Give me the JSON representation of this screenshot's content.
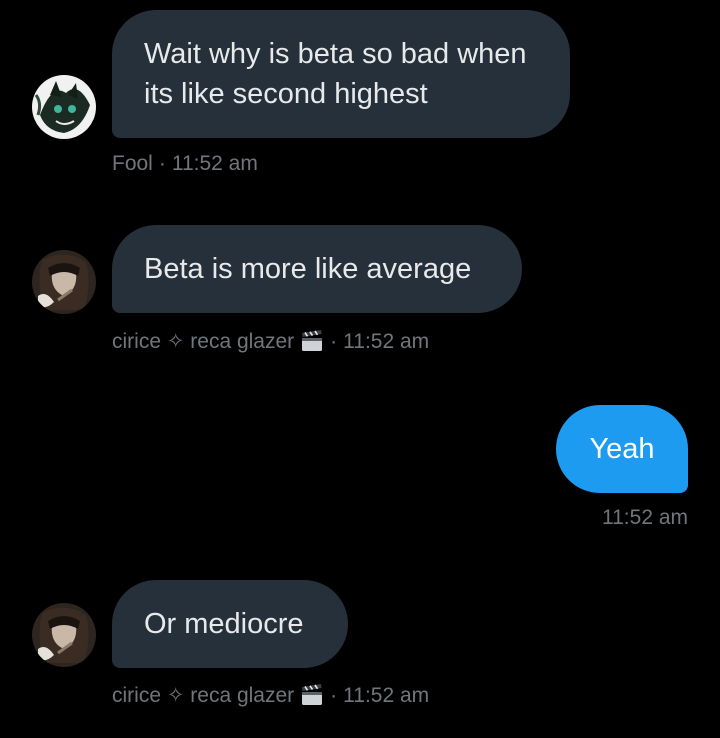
{
  "conversation": {
    "messages": [
      {
        "sender": "Fool",
        "text": "Wait why is beta so bad when its like second highest",
        "time": "11:52 am",
        "direction": "incoming"
      },
      {
        "sender": "cirice ✧ reca glazer",
        "text": "Beta is more like average",
        "time": "11:52 am",
        "direction": "incoming"
      },
      {
        "sender": "",
        "text": "Yeah",
        "time": "11:52 am",
        "direction": "outgoing"
      },
      {
        "sender": "cirice ✧ reca glazer",
        "text": "Or mediocre",
        "time": "11:52 am",
        "direction": "incoming"
      }
    ]
  },
  "separator": "·",
  "icons": {
    "sender_badge": "clapperboard-icon"
  },
  "colors": {
    "background": "#000000",
    "incoming_bubble": "#25303b",
    "outgoing_bubble": "#1d9bf0",
    "text": "#e7e9ea",
    "meta_text": "#71767b"
  }
}
